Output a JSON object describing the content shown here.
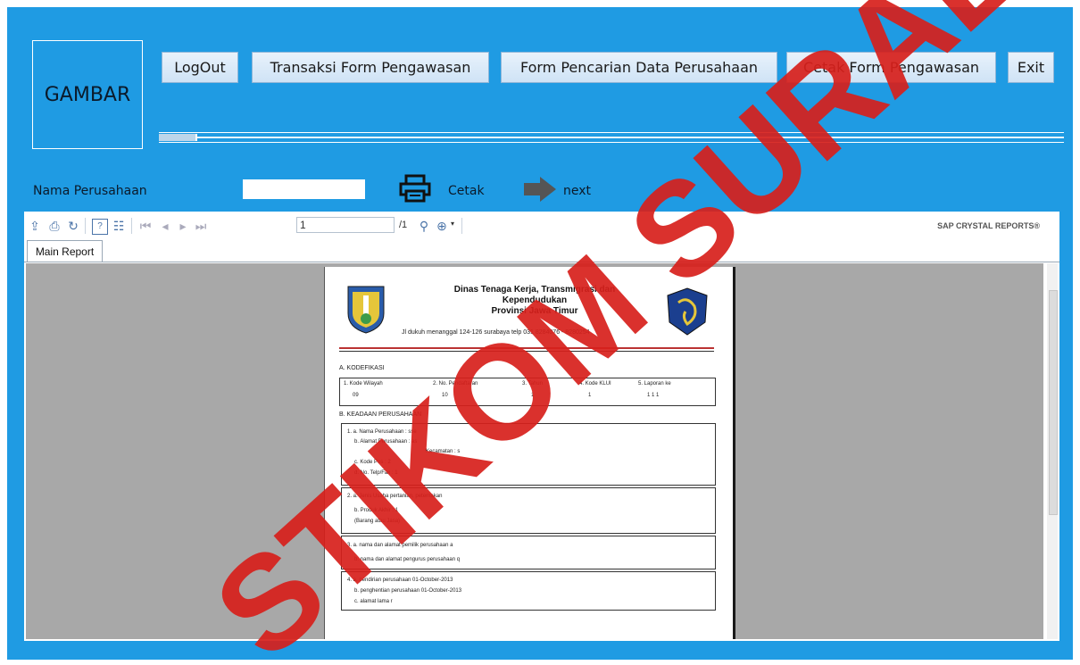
{
  "logo_box": {
    "label": "GAMBAR"
  },
  "nav": {
    "logout": "LogOut",
    "transaksi": "Transaksi Form Pengawasan",
    "pencarian": "Form Pencarian Data Perusahaan",
    "cetak_form": "Cetak Form Pengawasan",
    "exit": "Exit"
  },
  "progress": {
    "value": 0.04
  },
  "form": {
    "nama_label": "Nama Perusahaan",
    "nama_value": "",
    "cetak_label": "Cetak",
    "next_label": "next"
  },
  "viewer": {
    "page_value": "1",
    "page_total": "/1",
    "brand": "SAP CRYSTAL REPORTS®",
    "tab_main": "Main Report"
  },
  "report": {
    "title_line1": "Dinas Tenaga Kerja, Transmigrasi dan",
    "title_line2": "Kependudukan",
    "title_line3": "Provinsi Jawa Timur",
    "address": "Jl dukuh menanggal 124-126 surabaya telp 031 8284076 - 8280254",
    "section_a": "A.      KODEFIKASI",
    "kode_headers": [
      "1. Kode Wilayah",
      "2. No. Pendaftaran",
      "3. Tahun",
      "4. Kode KLUI",
      "5. Laporan ke"
    ],
    "kode_values": [
      "09",
      "10",
      "1",
      "1",
      "1   1   1"
    ],
    "section_b": "B.      KEADAAN PERUSAHAAN",
    "b1": [
      "1.  a. Nama Perusahaan   :    sse",
      "b. Alamat Perusahaan  :    as",
      "Kecamatan  :   s",
      "c. Kode Pos             :    2",
      "d. No. Telp/Fax         :    1"
    ],
    "b2": [
      "2.  a. Jenis Usaha              pertanian, peternakan",
      "b. Produk Akhir          :   1",
      "(Barang atau Jasa)"
    ],
    "b3": [
      "3.  a. nama dan alamat pemilik perusahaan   a",
      "b. nama dan alamat pengurus perusahaan   q"
    ],
    "b4": [
      "4.  a. pendirian perusahaan     01-October-2013",
      "b. penghentian perusahaan    01-October-2013",
      "c. alamat lama   r"
    ]
  },
  "watermark": {
    "text": "STIKOM SURABAYA",
    "color": "#d7201b"
  }
}
